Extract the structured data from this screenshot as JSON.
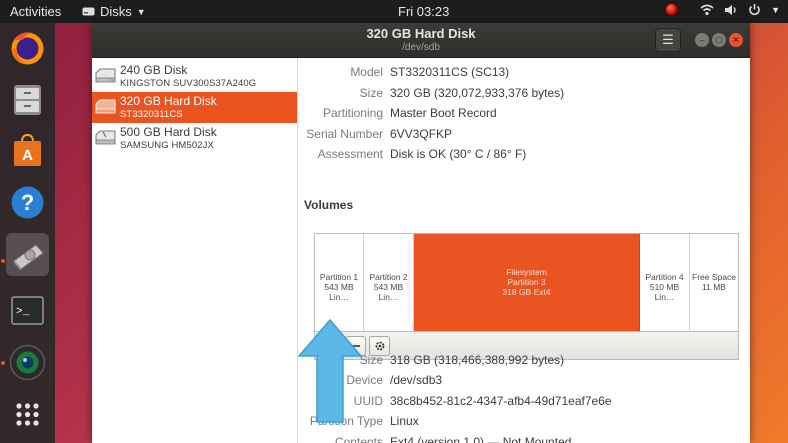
{
  "topbar": {
    "activities": "Activities",
    "app_name": "Disks",
    "clock": "Fri 03:23"
  },
  "window": {
    "title": "320 GB Hard Disk",
    "subtitle": "/dev/sdb"
  },
  "disks": [
    {
      "name": "240 GB Disk",
      "model": "KINGSTON SUV300S37A240G"
    },
    {
      "name": "320 GB Hard Disk",
      "model": "ST3320311CS"
    },
    {
      "name": "500 GB Hard Disk",
      "model": "SAMSUNG HM502JX"
    }
  ],
  "drive_props": [
    {
      "key": "Model",
      "value": "ST3320311CS (SC13)"
    },
    {
      "key": "Size",
      "value": "320 GB (320,072,933,376 bytes)"
    },
    {
      "key": "Partitioning",
      "value": "Master Boot Record"
    },
    {
      "key": "Serial Number",
      "value": "6VV3QFKP"
    },
    {
      "key": "Assessment",
      "value": "Disk is OK (30° C / 86° F)"
    }
  ],
  "volumes_title": "Volumes",
  "partitions": [
    {
      "line1": "Partition 1",
      "line2": "543 MB Lin…",
      "line3": ""
    },
    {
      "line1": "Partition 2",
      "line2": "543 MB Lin…",
      "line3": ""
    },
    {
      "line1": "Filesystem",
      "line2": "Partition 3",
      "line3": "318 GB Ext4"
    },
    {
      "line1": "Partition 4",
      "line2": "510 MB Lin…",
      "line3": ""
    },
    {
      "line1": "Free Space",
      "line2": "11 MB",
      "line3": ""
    }
  ],
  "volume_props": [
    {
      "key": "Size",
      "value": "318 GB (318,466,388,992 bytes)"
    },
    {
      "key": "Device",
      "value": "/dev/sdb3"
    },
    {
      "key": "UUID",
      "value": "38c8b452-81c2-4347-afb4-49d71eaf7e6e"
    },
    {
      "key": "Partition Type",
      "value": "Linux"
    },
    {
      "key": "Contents",
      "value": "Ext4 (version 1.0) — Not Mounted"
    }
  ],
  "colors": {
    "accent": "#e95420",
    "arrow": "#5bb8e6"
  },
  "icons": {
    "play": "play-icon",
    "minus": "minus-icon",
    "gear": "gear-icon"
  }
}
